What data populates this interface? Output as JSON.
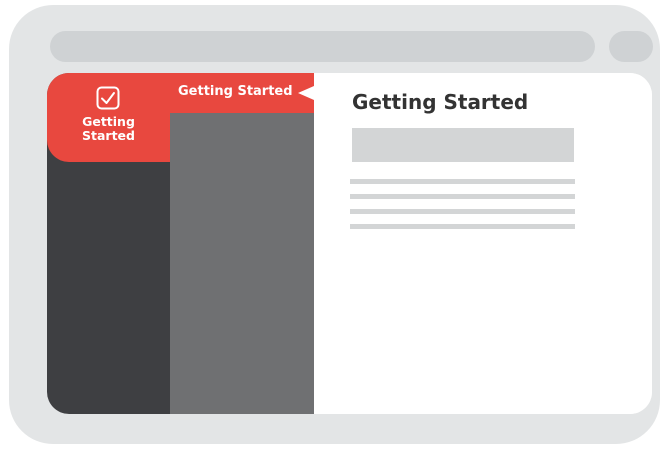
{
  "rail": {
    "items": [
      {
        "label": "Getting\nStarted",
        "icon": "checkbox-check-icon",
        "active": true
      }
    ]
  },
  "subnav": {
    "items": [
      {
        "label": "Getting Started",
        "active": true
      }
    ]
  },
  "main": {
    "title": "Getting Started"
  },
  "colors": {
    "accent": "#e8483f",
    "rail_bg": "#3e3f42",
    "subnav_bg": "#6f7072",
    "frame_bg": "#e3e5e6",
    "placeholder": "#d3d5d6"
  }
}
